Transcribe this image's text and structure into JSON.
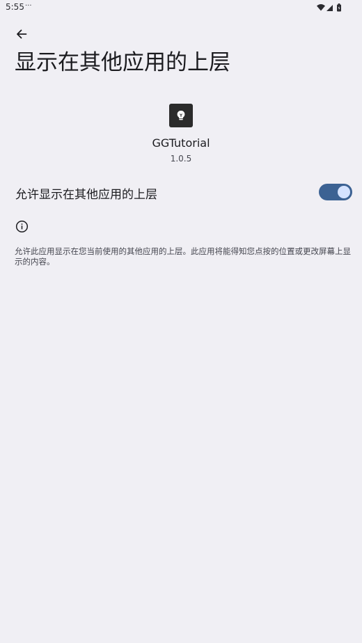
{
  "status_bar": {
    "time": "5:55",
    "overflow": "···",
    "icons": [
      "wifi-icon",
      "signal-icon",
      "battery-icon"
    ]
  },
  "header": {
    "back_icon": "arrow-back-icon",
    "title": "显示在其他应用的上层"
  },
  "app": {
    "icon": "lightbulb-icon",
    "name": "GGTutorial",
    "version": "1.0.5"
  },
  "permission": {
    "label": "允许显示在其他应用的上层",
    "enabled": true
  },
  "info": {
    "icon": "info-icon",
    "description": "允许此应用显示在您当前使用的其他应用的上层。此应用将能得知您点按的位置或更改屏幕上显示的内容。"
  },
  "colors": {
    "background": "#f0eff4",
    "switch_track": "#3c6293",
    "switch_thumb": "#d5e3ff",
    "app_icon_bg": "#2b2b2b"
  }
}
